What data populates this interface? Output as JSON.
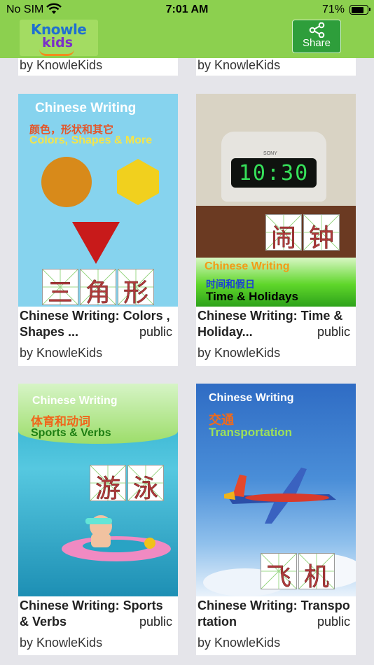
{
  "status_bar": {
    "carrier": "No SIM",
    "time": "7:01 AM",
    "battery": "71%"
  },
  "nav": {
    "logo_line1": "Knowle",
    "logo_line2": "kids",
    "share_label": "Share"
  },
  "top_partial": [
    {
      "author": "by KnowleKids"
    },
    {
      "author": "by KnowleKids"
    }
  ],
  "cards": [
    {
      "title": "Chinese Writing: Colors , Shapes ...",
      "visibility": "public",
      "author": "by KnowleKids",
      "cover": {
        "heading": "Chinese Writing",
        "zh": "颜色，形状和其它",
        "en": "Colors, Shapes & More",
        "chars": [
          "三",
          "角",
          "形"
        ]
      }
    },
    {
      "title": "Chinese Writing: Time & Holiday...",
      "visibility": "public",
      "author": "by KnowleKids",
      "cover": {
        "clock_brand": "SONY",
        "clock_time": "10:30",
        "heading": "Chinese Writing",
        "zh": "时间和假日",
        "en": "Time & Holidays",
        "chars": [
          "闹",
          "钟"
        ]
      }
    },
    {
      "title": "Chinese Writing: Sports & Verbs",
      "visibility": "public",
      "author": "by KnowleKids",
      "cover": {
        "heading": "Chinese Writing",
        "zh": "体育和动词",
        "en": "Sports & Verbs",
        "chars": [
          "游",
          "泳"
        ]
      }
    },
    {
      "title": "Chinese Writing: Transportation",
      "visibility": "public",
      "author": "by KnowleKids",
      "cover": {
        "heading": "Chinese Writing",
        "zh": "交通",
        "en": "Transportation",
        "chars": [
          "飞",
          "机"
        ]
      }
    }
  ]
}
